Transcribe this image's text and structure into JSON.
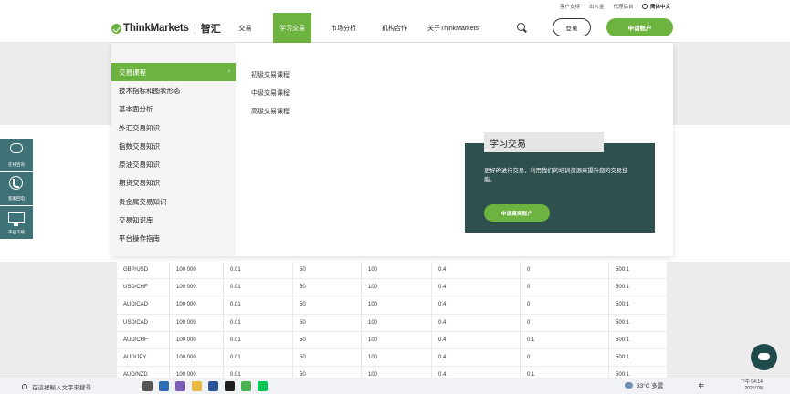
{
  "utility_bar": {
    "links": [
      "客户支持",
      "出入金",
      "代理后台"
    ],
    "language": "简体中文"
  },
  "header": {
    "logo_text": "ThinkMarkets",
    "logo_cn": "智汇",
    "nav": [
      "交易",
      "学习交易",
      "市场分析",
      "机构合作",
      "关于ThinkMarkets"
    ],
    "login_label": "登录",
    "apply_label": "申请账户"
  },
  "menu": {
    "categories": [
      "交易课程",
      "技术指标和图表形态",
      "基本面分析",
      "外汇交易知识",
      "指数交易知识",
      "原油交易知识",
      "期货交易知识",
      "贵金属交易知识",
      "交易知识库",
      "平台操作指南"
    ],
    "subitems": [
      "初级交易课程",
      "中级交易课程",
      "高级交易课程"
    ],
    "promo": {
      "title": "学习交易",
      "description": "更好的进行交易，利用我们的培训资源来提升您的交易技能。",
      "button": "申请真实账户"
    }
  },
  "side_buttons": [
    "在线咨询",
    "客服回电",
    "平台下载"
  ],
  "table": {
    "rows": [
      [
        "GBP/USD",
        "100 000",
        "0.01",
        "50",
        "100",
        "0.4",
        "0",
        "500:1"
      ],
      [
        "USD/CHF",
        "100 000",
        "0.01",
        "50",
        "100",
        "0.4",
        "0",
        "500:1"
      ],
      [
        "AUD/CAD",
        "100 000",
        "0.01",
        "50",
        "100",
        "0.4",
        "0",
        "500:1"
      ],
      [
        "USD/CAD",
        "100 000",
        "0.01",
        "50",
        "100",
        "0.4",
        "0",
        "500:1"
      ],
      [
        "AUD/CHF",
        "100 000",
        "0.01",
        "50",
        "100",
        "0.4",
        "0.1",
        "500:1"
      ],
      [
        "AUD/JPY",
        "100 000",
        "0.01",
        "50",
        "100",
        "0.4",
        "0",
        "500:1"
      ],
      [
        "AUD/NZD",
        "100 000",
        "0.01",
        "50",
        "100",
        "0.4",
        "0.1",
        "500:1"
      ]
    ]
  },
  "taskbar": {
    "search_placeholder": "在這裡輸入文字來搜尋",
    "weather": "33°C 多雲",
    "ime": "中",
    "time": "下午 04:14",
    "date": "2025/7/8"
  }
}
